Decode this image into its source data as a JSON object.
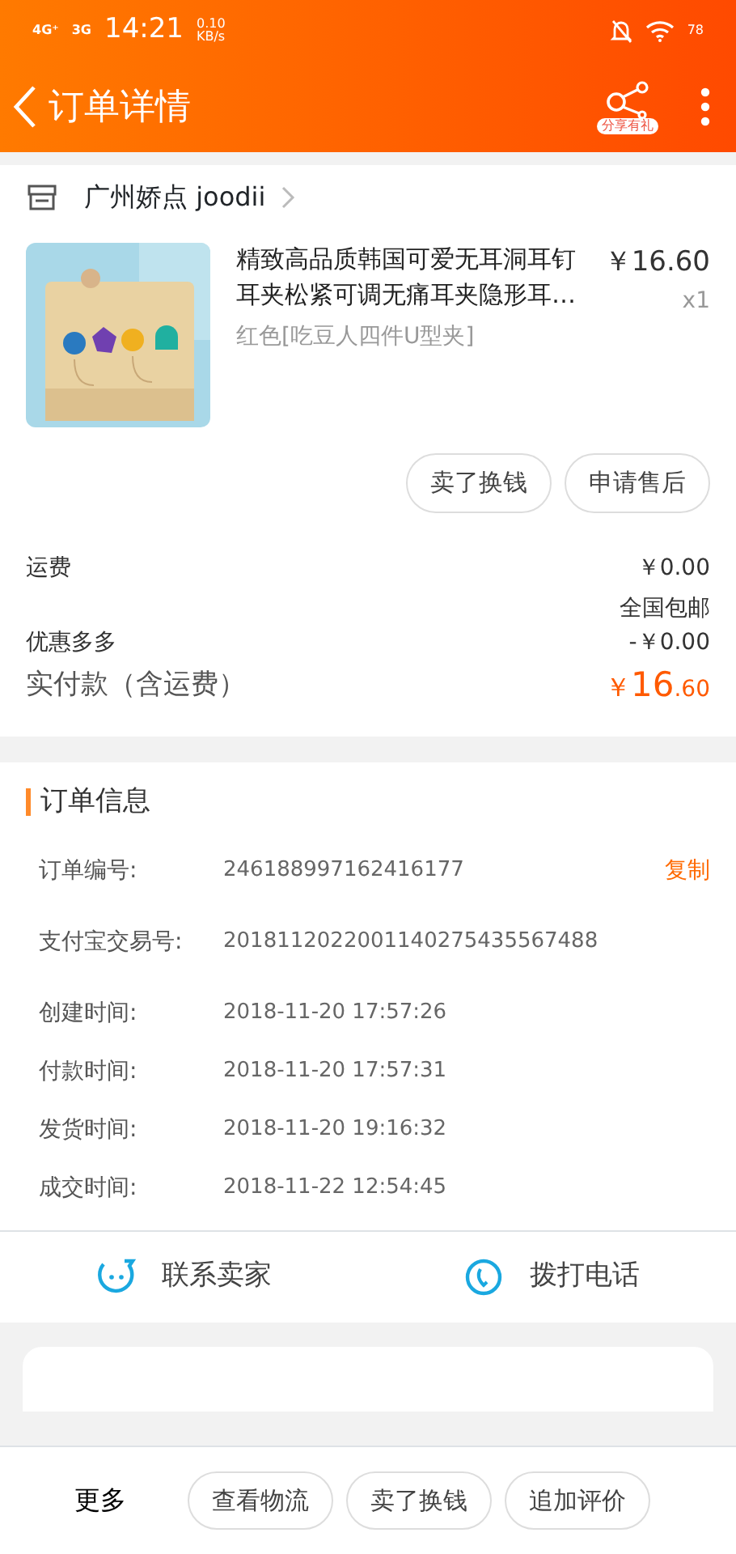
{
  "status_bar": {
    "network_1": "4G⁺",
    "network_2": "3G",
    "time": "14:21",
    "speed": "0.10",
    "speed_unit": "KB/s",
    "battery": "78"
  },
  "header": {
    "title": "订单详情",
    "share_label": "分享有礼"
  },
  "shop": {
    "name": "广州娇点 joodii"
  },
  "product": {
    "kind": "picture",
    "title": "精致高品质韩国可爱无耳洞耳钉耳夹松紧可调无痛耳夹隐形耳…",
    "price": "￥16.60",
    "quantity": "x1",
    "variant": "红色[吃豆人四件U型夹]"
  },
  "item_actions": [
    "卖了换钱",
    "申请售后"
  ],
  "fees": [
    {
      "label": "运费",
      "value": "￥0.00",
      "note": "全国包邮"
    },
    {
      "label": "优惠多多",
      "value": "-￥0.00"
    }
  ],
  "total": {
    "label": "实付款（含运费）",
    "currency": "￥",
    "integer": "16",
    "decimal": ".60"
  },
  "order_info": {
    "title": "订单信息",
    "copy_label": "复制",
    "rows": [
      {
        "label": "订单编号:",
        "value": "246188997162416177"
      },
      {
        "label": "支付宝交易号:",
        "value": "2018112022001140275435567488"
      },
      {
        "label": "创建时间:",
        "value": "2018-11-20 17:57:26"
      },
      {
        "label": "付款时间:",
        "value": "2018-11-20 17:57:31"
      },
      {
        "label": "发货时间:",
        "value": "2018-11-20 19:16:32"
      },
      {
        "label": "成交时间:",
        "value": "2018-11-22 12:54:45"
      }
    ]
  },
  "contact": [
    {
      "kind": "chat",
      "label": "联系卖家"
    },
    {
      "kind": "phone",
      "label": "拨打电话"
    }
  ],
  "bottom_bar": {
    "more": "更多",
    "buttons": [
      "查看物流",
      "卖了换钱",
      "追加评价"
    ]
  }
}
